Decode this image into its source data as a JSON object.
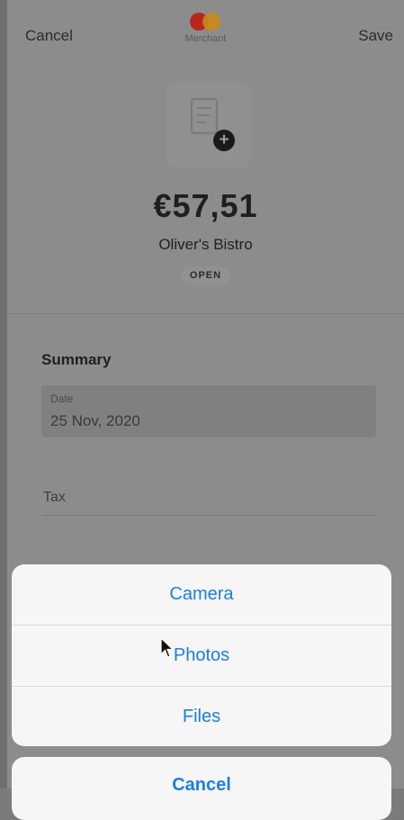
{
  "header": {
    "cancel_label": "Cancel",
    "save_label": "Save",
    "brand_label": "Merchant",
    "brand_colors": [
      "#b8261d",
      "#c98a1a"
    ]
  },
  "transaction": {
    "amount": "€57,51",
    "merchant": "Oliver's Bistro",
    "status": "OPEN"
  },
  "summary": {
    "title": "Summary",
    "date_label": "Date",
    "date_value": "25 Nov, 2020",
    "tax_label": "Tax"
  },
  "action_sheet": {
    "options": [
      "Camera",
      "Photos",
      "Files"
    ],
    "cancel_label": "Cancel",
    "accent_color": "#1a7ee8"
  },
  "icons": {
    "receipt": "receipt-add-icon",
    "cursor": "mouse-pointer-icon"
  }
}
